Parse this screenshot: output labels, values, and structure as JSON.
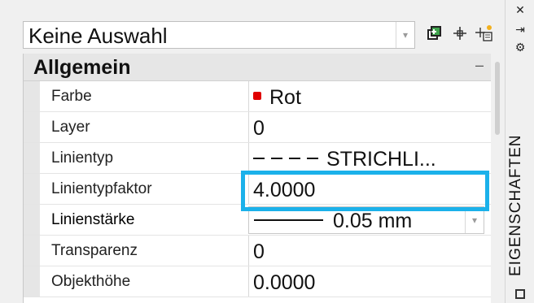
{
  "selection": {
    "value": "Keine Auswahl"
  },
  "toolbar": {
    "icons": [
      "select-objects-icon",
      "pickadd-icon",
      "quick-select-icon"
    ]
  },
  "category": {
    "label": "Allgemein",
    "collapse": "–"
  },
  "rows": [
    {
      "label": "Farbe",
      "value": "Rot",
      "swatch": "#e00000"
    },
    {
      "label": "Layer",
      "value": "0"
    },
    {
      "label": "Linientyp",
      "value": "STRICHLI..."
    },
    {
      "label": "Linientypfaktor",
      "value": "4.0000"
    },
    {
      "label": "Linienstärke",
      "value": "0.05 mm"
    },
    {
      "label": "Transparenz",
      "value": "0"
    },
    {
      "label": "Objekthöhe",
      "value": "0.0000"
    }
  ],
  "side": {
    "title": "EIGENSCHAFTEN",
    "close": "✕",
    "autohide": "⇥",
    "settings": "⚙"
  },
  "colors": {
    "highlight": "#1bb1ea",
    "swatch_red": "#e00000"
  }
}
